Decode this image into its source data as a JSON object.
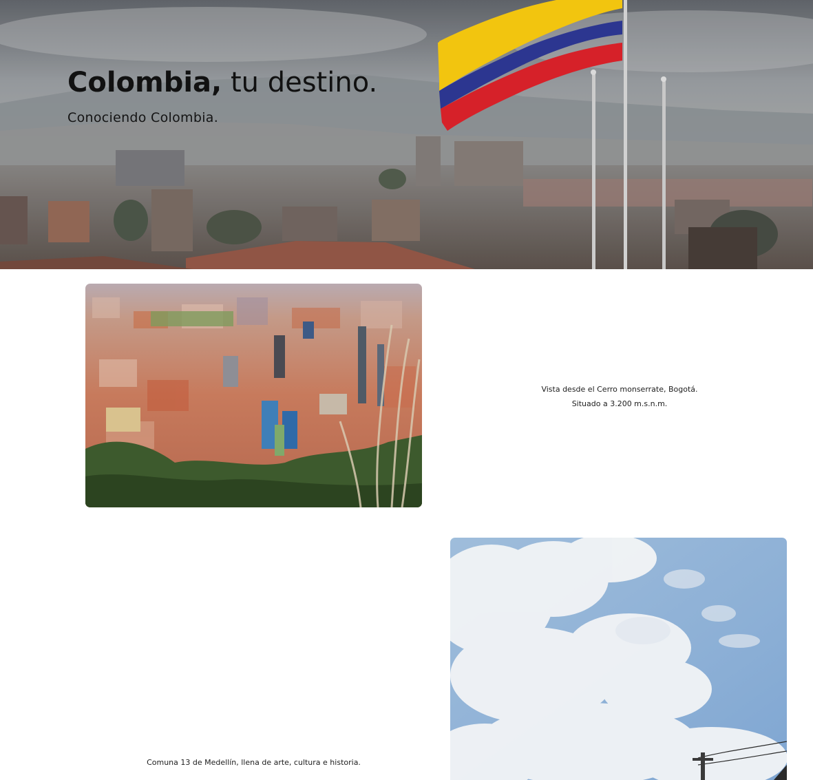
{
  "hero": {
    "title_strong": "Colombia,",
    "title_rest": " tu destino.",
    "subtitle": "Conociendo Colombia.",
    "flag_colors": [
      "#f2c200",
      "#1f2a8a",
      "#d4141c"
    ]
  },
  "sections": [
    {
      "image": "bogota-aerial-view-photo",
      "caption_line1": "Vista desde el Cerro monserrate, Bogotá.",
      "caption_line2": "Situado a 3.200 m.s.n.m."
    },
    {
      "image": "medellin-sky-photo",
      "caption_line1": "Comuna 13 de Medellín, llena de arte, cultura e historia."
    }
  ]
}
